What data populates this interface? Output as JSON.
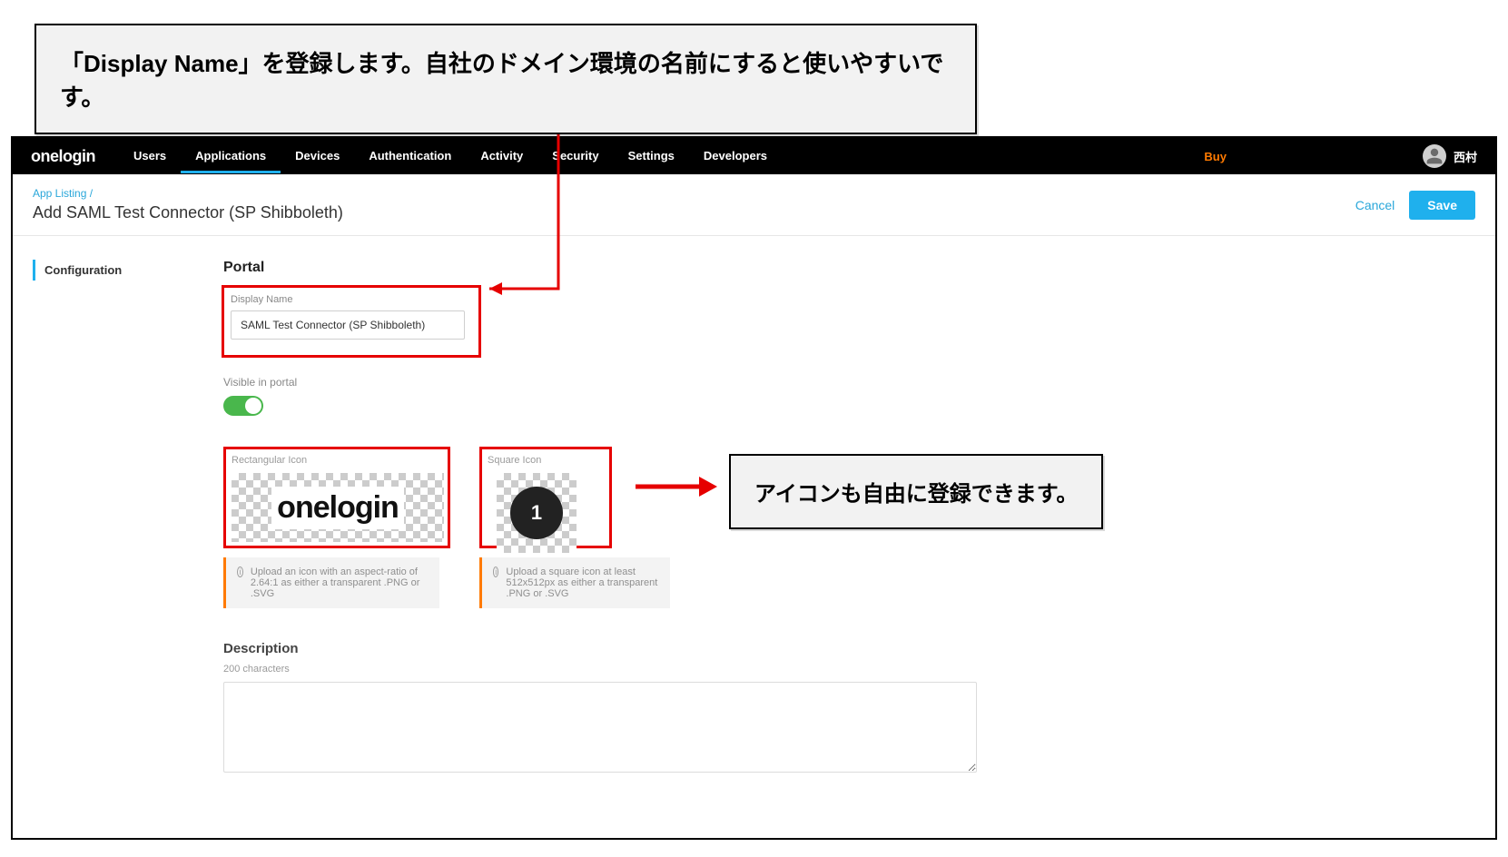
{
  "callouts": {
    "top": "「Display Name」を登録します。自社のドメイン環境の名前にすると使いやすいです。",
    "right": "アイコンも自由に登録できます。"
  },
  "brand": "onelogin",
  "nav": {
    "items": [
      "Users",
      "Applications",
      "Devices",
      "Authentication",
      "Activity",
      "Security",
      "Settings",
      "Developers"
    ],
    "active": "Applications"
  },
  "buy": "Buy",
  "user": {
    "name": "西村"
  },
  "page": {
    "breadcrumb_parent": "App Listing /",
    "title": "Add SAML Test Connector (SP Shibboleth)",
    "cancel": "Cancel",
    "save": "Save"
  },
  "sidenav": {
    "items": [
      "Configuration"
    ]
  },
  "portal": {
    "heading": "Portal",
    "display_name_label": "Display Name",
    "display_name_value": "SAML Test Connector (SP Shibboleth)",
    "visible_label": "Visible in portal",
    "visible_on": true,
    "rect_label": "Rectangular Icon",
    "rect_logo_text": "onelogin",
    "rect_hint": "Upload an icon with an aspect-ratio of 2.64:1 as either a transparent .PNG or .SVG",
    "square_label": "Square Icon",
    "square_glyph": "1",
    "square_hint": "Upload a square icon at least 512x512px as either a transparent .PNG or .SVG"
  },
  "description": {
    "heading": "Description",
    "counter": "200 characters"
  }
}
